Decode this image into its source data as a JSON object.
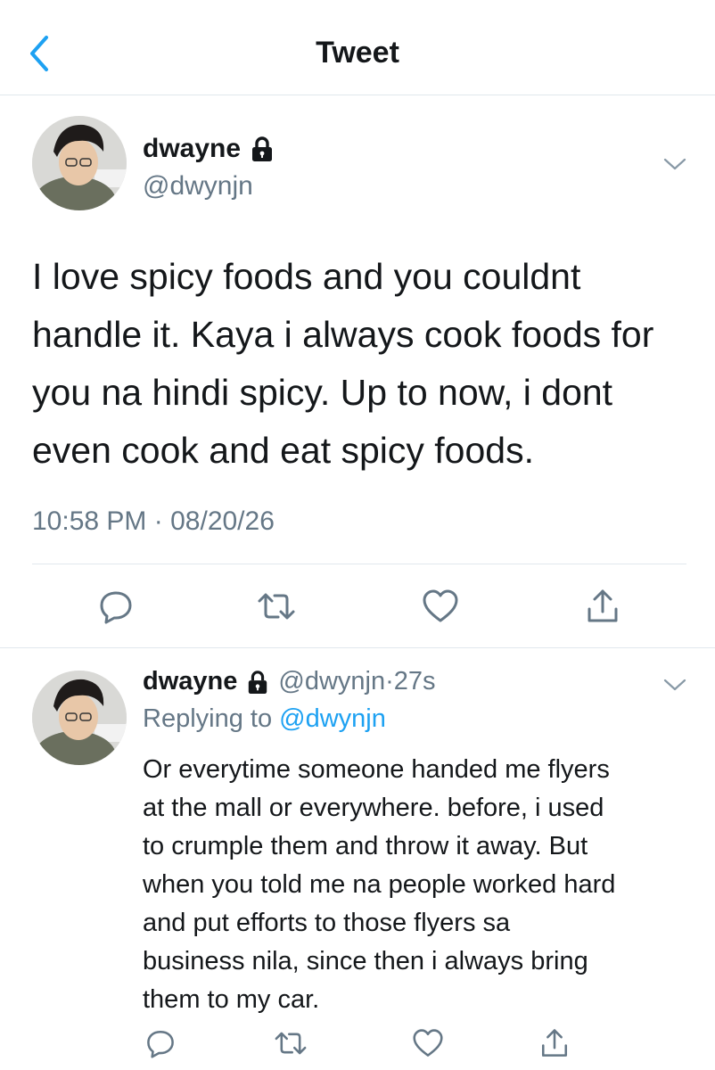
{
  "header": {
    "title": "Tweet",
    "back_icon": "chevron-left-icon",
    "accent": "#1da1f2"
  },
  "main_tweet": {
    "author_name": "dwayne",
    "author_handle": "@dwynjn",
    "lock_icon": "lock-icon",
    "text": "I love spicy foods and you couldnt\nhandle it. Kaya i always cook foods for\nyou na hindi spicy. Up to now, i dont\neven cook and eat spicy foods.",
    "time": "10:58 PM",
    "date_sep": "·",
    "date": "08/20/26",
    "actions": [
      "reply-icon",
      "retweet-icon",
      "like-icon",
      "share-icon"
    ]
  },
  "reply_tweet": {
    "author_name": "dwayne",
    "author_handle": "@dwynjn",
    "dot": "·",
    "age": "27s",
    "replying_prefix": "Replying to",
    "replying_handle": "@dwynjn",
    "text": "Or everytime someone handed me flyers\nat the mall or everywhere. before, i used\nto crumple them and throw it away. But\nwhen you told me na people worked hard\nand put efforts to those flyers sa\nbusiness nila, since then i always bring\nthem to my car.",
    "actions": [
      "reply-icon",
      "retweet-icon",
      "like-icon",
      "share-icon"
    ]
  },
  "colors": {
    "text": "#14171a",
    "secondary": "#657786",
    "divider": "#e1e8ed",
    "link": "#1da1f2"
  }
}
